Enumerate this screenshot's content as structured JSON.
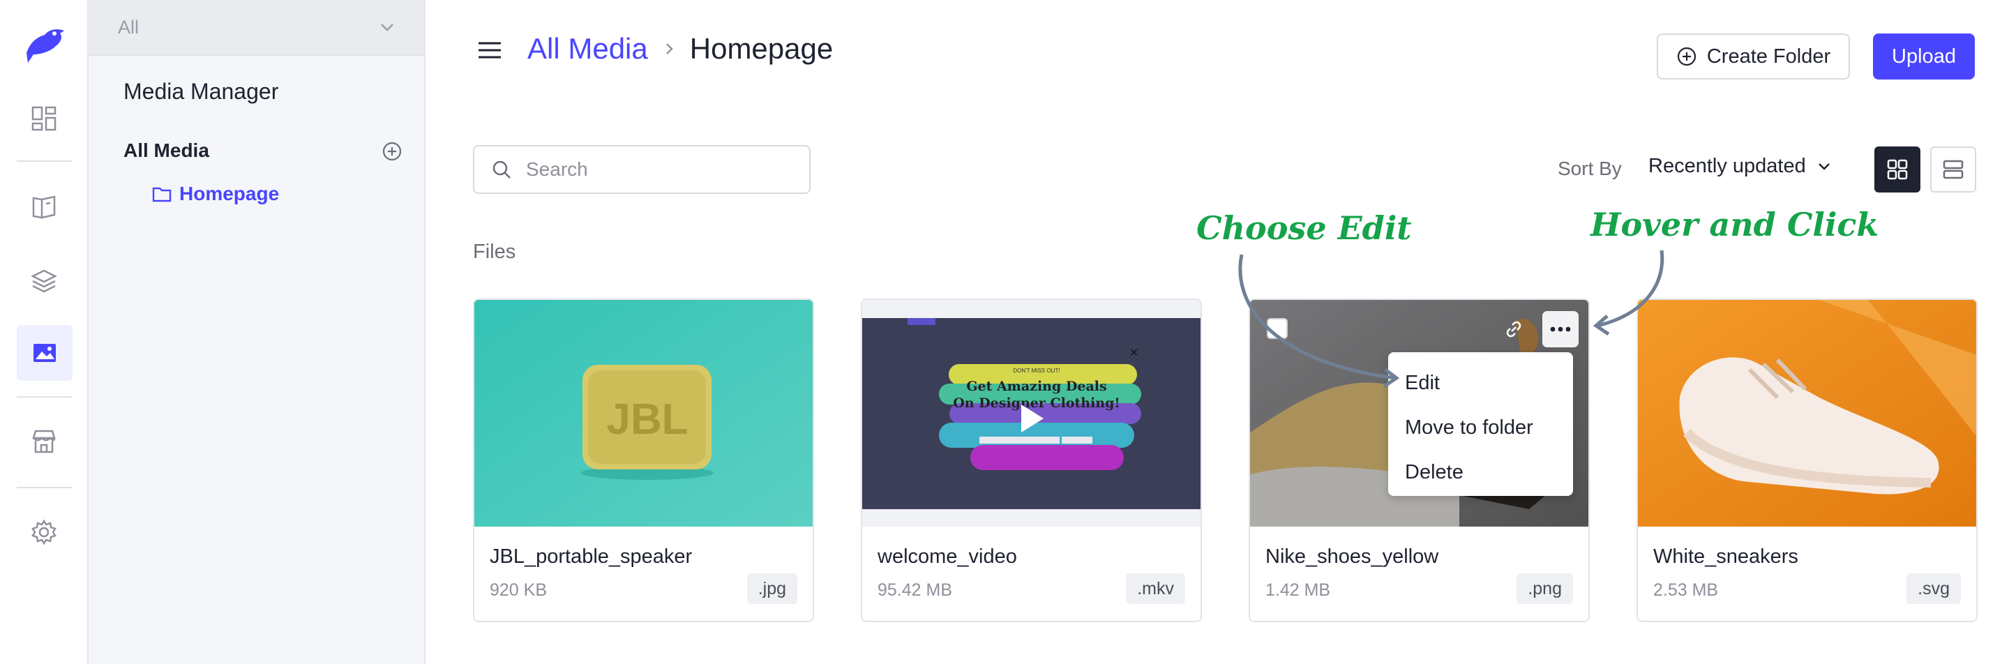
{
  "rail": {
    "items": [
      {
        "name": "logo",
        "icon": "bird-logo-icon"
      },
      {
        "name": "content-manager",
        "icon": "dashboard-grid-icon"
      },
      {
        "name": "content-type-builder",
        "icon": "book-icon"
      },
      {
        "name": "layers",
        "icon": "layers-icon"
      },
      {
        "name": "media-library",
        "icon": "image-icon",
        "active": true
      },
      {
        "name": "marketplace",
        "icon": "store-icon"
      },
      {
        "name": "settings",
        "icon": "gear-icon"
      }
    ]
  },
  "panel": {
    "select_value": "All",
    "title": "Media Manager",
    "all_media": "All Media",
    "folder": "Homepage"
  },
  "header": {
    "breadcrumb_root": "All Media",
    "breadcrumb_current": "Homepage",
    "create_folder": "Create Folder",
    "upload": "Upload"
  },
  "toolbar": {
    "search_placeholder": "Search",
    "sort_label": "Sort By",
    "sort_value": "Recently updated"
  },
  "files_label": "Files",
  "files": [
    {
      "name": "JBL_portable_speaker",
      "size": "920 KB",
      "ext": ".jpg",
      "thumb_text": "JBL"
    },
    {
      "name": "welcome_video",
      "size": "95.42 MB",
      "ext": ".mkv",
      "thumb_title": "Get Amazing Deals On Designer Clothing!",
      "thumb_kicker": "DON'T MISS OUT!"
    },
    {
      "name": "Nike_shoes_yellow",
      "size": "1.42 MB",
      "ext": ".png"
    },
    {
      "name": "White_sneakers",
      "size": "2.53 MB",
      "ext": ".svg"
    }
  ],
  "context_menu": [
    "Edit",
    "Move to folder",
    "Delete"
  ],
  "annotations": {
    "choose_edit": "Choose Edit",
    "hover_click": "Hover and Click"
  },
  "colors": {
    "primary": "#4945ff",
    "annotation": "#16a34a"
  }
}
